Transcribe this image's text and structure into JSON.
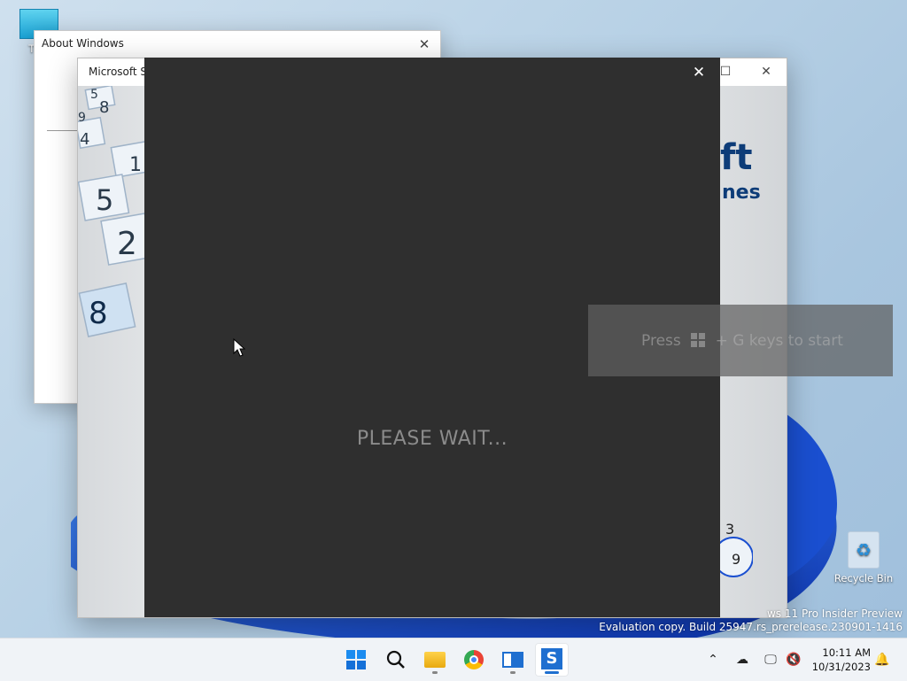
{
  "desktop": {
    "icons": [
      {
        "label": "This"
      },
      {
        "label": "Recycle Bin"
      }
    ],
    "watermark": {
      "line1": "ws 11 Pro Insider Preview",
      "line2": "Evaluation copy. Build 25947.rs_prerelease.230901-1416"
    }
  },
  "about_window": {
    "title": "About Windows",
    "close_glyph": "✕"
  },
  "sudoku_window": {
    "title": "Microsoft Sudoku",
    "brand_top": "ft",
    "brand_bottom": "nes",
    "tile_numbers": [
      "5",
      "8",
      "9",
      "4",
      "1",
      "5",
      "2",
      "8",
      "3",
      "9"
    ]
  },
  "splash": {
    "message": "PLEASE WAIT...",
    "close_glyph": "✕"
  },
  "gamebar_toast": {
    "prefix": "Press",
    "suffix": "+ G keys to start"
  },
  "taskbar": {
    "apps": [
      "start",
      "search",
      "file-explorer",
      "chrome",
      "terminal",
      "sudoku"
    ],
    "clock_time": "10:11 AM",
    "clock_date": "10/31/2023",
    "tray_chevron": "^"
  },
  "colors": {
    "splash_bg": "#2f2f2f",
    "accent": "#1f6fd0",
    "brand": "#0d3c78"
  }
}
